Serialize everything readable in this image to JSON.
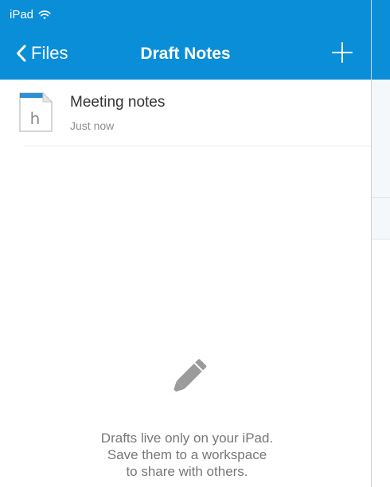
{
  "status_bar": {
    "device": "iPad",
    "wifi_icon": "wifi-icon"
  },
  "navbar": {
    "back_label": "Files",
    "title": "Draft Notes",
    "add_icon": "plus-icon",
    "color": "#0a8ed8"
  },
  "notes": [
    {
      "title": "Meeting notes",
      "timestamp": "Just now",
      "icon": "hackpad-document-icon",
      "icon_letter": "h"
    }
  ],
  "empty_state": {
    "icon": "pencil-icon",
    "line1": "Drafts live only on your iPad.",
    "line2": "Save them to a workspace",
    "line3": "to share with others."
  }
}
